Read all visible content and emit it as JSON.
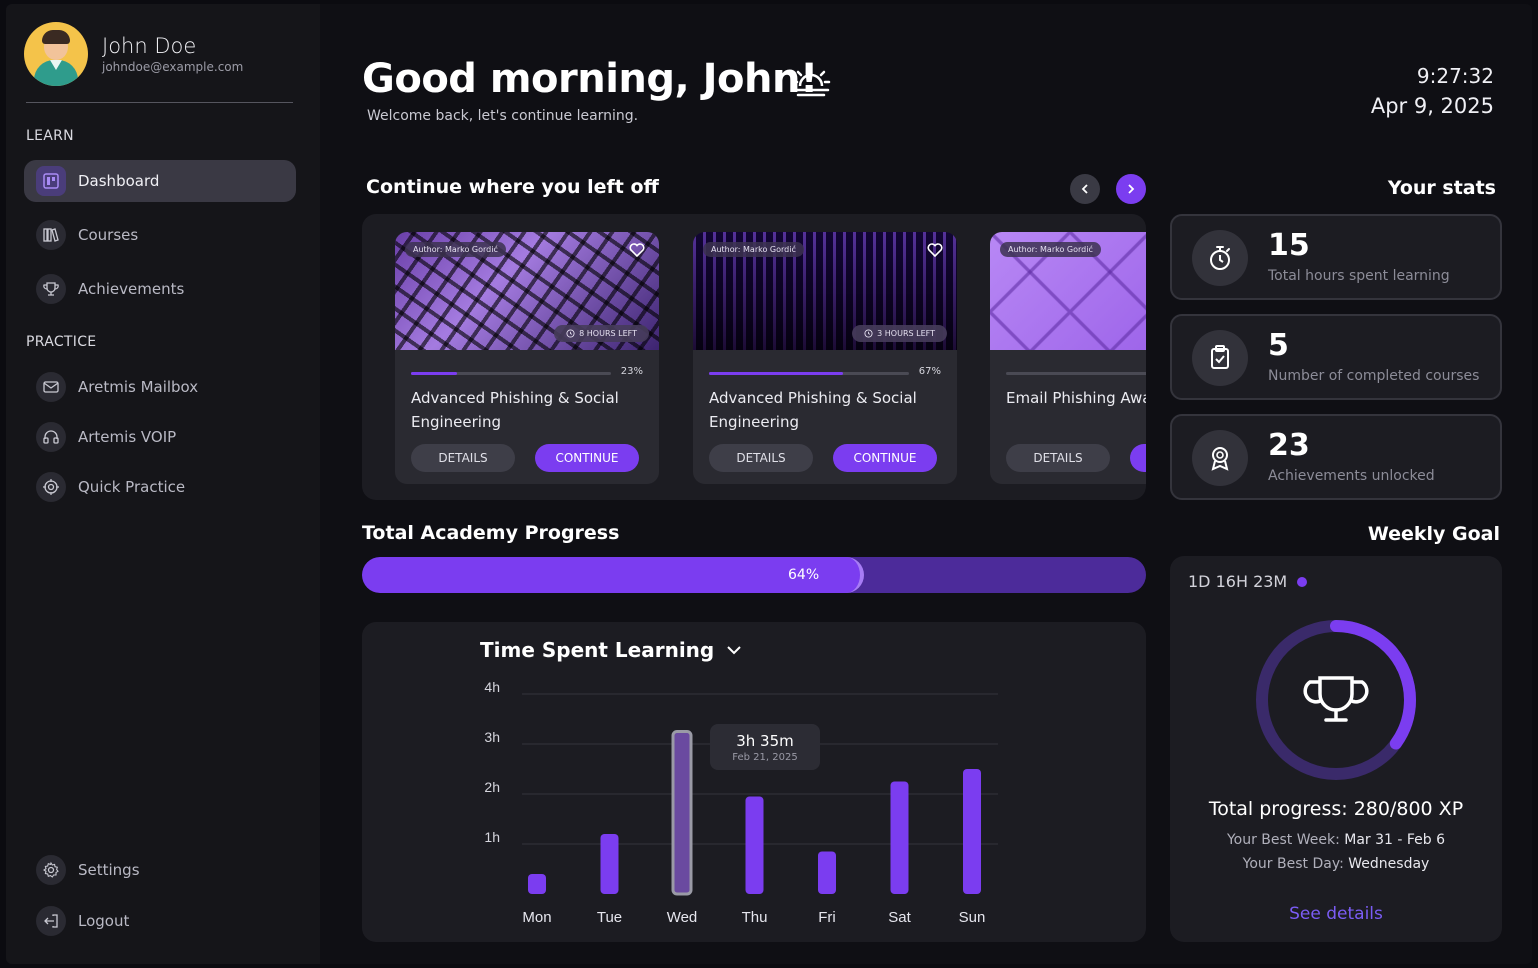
{
  "user": {
    "name": "John Doe",
    "email": "johndoe@example.com"
  },
  "sidebar": {
    "learn_label": "LEARN",
    "practice_label": "PRACTICE",
    "learn_items": [
      {
        "label": "Dashboard",
        "icon": "dashboard-icon",
        "active": true
      },
      {
        "label": "Courses",
        "icon": "books-icon"
      },
      {
        "label": "Achievements",
        "icon": "trophy-icon"
      }
    ],
    "practice_items": [
      {
        "label": "Aretmis Mailbox",
        "icon": "mail-icon"
      },
      {
        "label": "Artemis VOIP",
        "icon": "headset-icon"
      },
      {
        "label": "Quick Practice",
        "icon": "target-icon"
      }
    ],
    "bottom_items": [
      {
        "label": "Settings",
        "icon": "gear-icon"
      },
      {
        "label": "Logout",
        "icon": "logout-icon"
      }
    ]
  },
  "header": {
    "greeting": "Good morning, John!",
    "welcome": "Welcome back, let's continue learning.",
    "time": "9:27:32",
    "date": "Apr 9, 2025"
  },
  "continue": {
    "title": "Continue where you left off",
    "courses": [
      {
        "author": "Author: Marko Gordić",
        "time_left": "8 HOURS LEFT",
        "progress": 23,
        "progress_label": "23%",
        "title": "Advanced Phishing & Social Engineering",
        "details": "DETAILS",
        "continue": "CONTINUE"
      },
      {
        "author": "Author: Marko Gordić",
        "time_left": "3 HOURS LEFT",
        "progress": 67,
        "progress_label": "67%",
        "title": "Advanced Phishing & Social Engineering",
        "details": "DETAILS",
        "continue": "CONTINUE"
      },
      {
        "author": "Author: Marko Gordić",
        "title": "Email Phishing Awar",
        "details": "DETAILS"
      }
    ]
  },
  "stats": {
    "title": "Your stats",
    "items": [
      {
        "value": "15",
        "label": "Total hours spent learning",
        "icon": "stopwatch-icon"
      },
      {
        "value": "5",
        "label": "Number of completed courses",
        "icon": "clipboard-check-icon"
      },
      {
        "value": "23",
        "label": "Achievements unlocked",
        "icon": "badge-icon"
      }
    ]
  },
  "academy": {
    "title": "Total Academy Progress",
    "progress": 0.64,
    "label": "64%"
  },
  "chart_data": {
    "type": "bar",
    "title": "Time Spent Learning",
    "categories": [
      "Mon",
      "Tue",
      "Wed",
      "Thu",
      "Fri",
      "Sat",
      "Sun"
    ],
    "values": [
      0.4,
      1.2,
      3.25,
      1.95,
      0.85,
      2.25,
      2.5
    ],
    "ylim": [
      0,
      4
    ],
    "yticks": [
      "1h",
      "2h",
      "3h",
      "4h"
    ],
    "highlight_index": 2,
    "tooltip": {
      "value": "3h 35m",
      "date": "Feb 21, 2025"
    },
    "colors": {
      "bar": "#7b3df0",
      "highlight": "#6a4aa0"
    }
  },
  "weekly_goal": {
    "title": "Weekly Goal",
    "timer": "1D 16H 23M",
    "progress": 0.35,
    "total_label": "Total progress: ",
    "total_value": "280/800 XP",
    "best_week_label": "Your Best Week: ",
    "best_week_value": "Mar 31 - Feb 6",
    "best_day_label": "Your Best Day: ",
    "best_day_value": "Wednesday",
    "see_details": "See details"
  },
  "colors": {
    "accent": "#7b3df0",
    "background": "#0f0f14",
    "card": "#1c1c22"
  }
}
